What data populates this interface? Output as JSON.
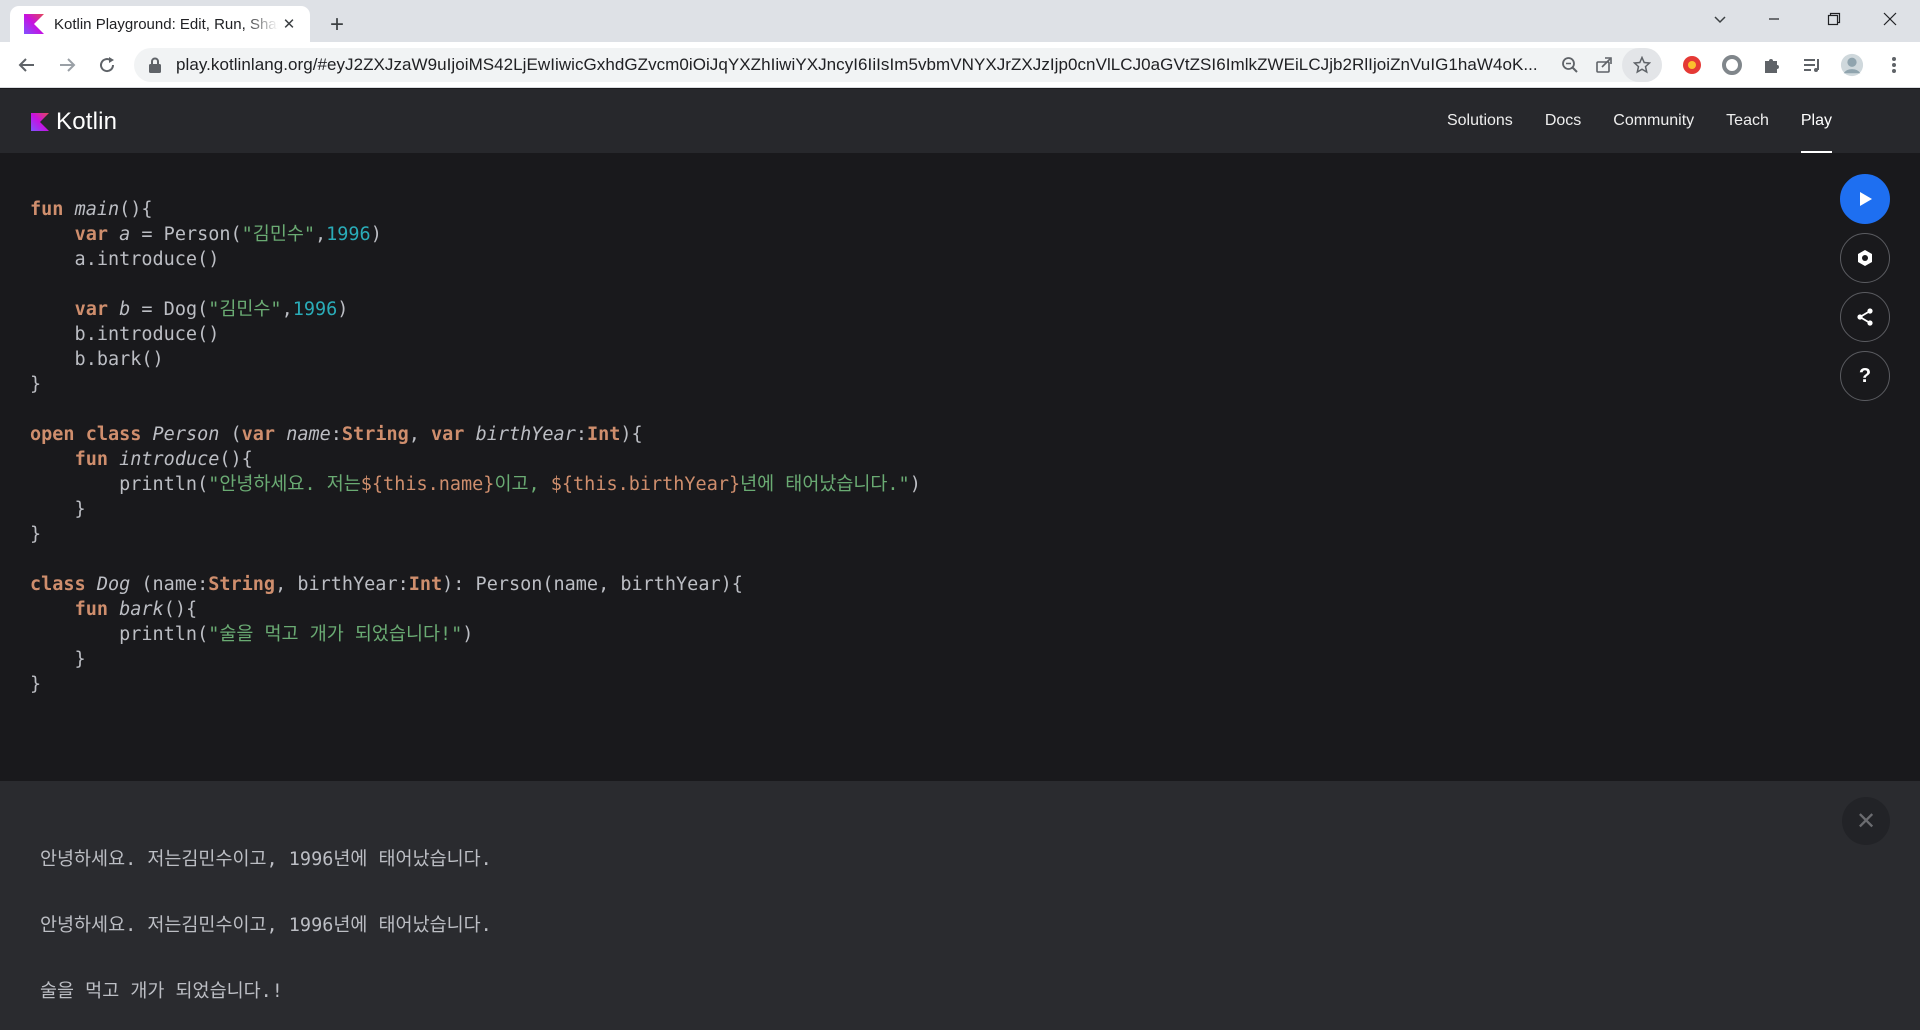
{
  "browser": {
    "tab_title": "Kotlin Playground: Edit, Run, Share Kotlin Code Online",
    "url": "play.kotlinlang.org/#eyJ2ZXJzaW9uIjoiMS42LjEwIiwicGxhdGZvcm0iOiJqYXZhIiwiYXJncyI6IiIsIm5vbmVNYXJrZXJzIjp0cnVlLCJ0aGVtZSI6ImlkZWEiLCJjb2RlIjoiZnVuIG1haW4oK...",
    "icons": [
      "back-icon",
      "forward-icon",
      "reload-icon",
      "lock-icon",
      "zoom-icon",
      "share-icon",
      "bookmark-star-icon",
      "extensions-icon",
      "reading-list-icon",
      "profile-avatar"
    ]
  },
  "header": {
    "logo_text": "Kotlin",
    "nav": [
      "Solutions",
      "Docs",
      "Community",
      "Teach",
      "Play"
    ],
    "active_nav": "Play"
  },
  "editor": {
    "lines": [
      "fun main(){",
      "    var a = Person(\"김민수\",1996)",
      "    a.introduce()",
      "",
      "    var b = Dog(\"김민수\",1996)",
      "    b.introduce()",
      "    b.bark()",
      "}",
      "",
      "open class Person (var name:String, var birthYear:Int){",
      "    fun introduce(){",
      "        println(\"안녕하세요. 저는${this.name}이고, ${this.birthYear}년에 태어났습니다.\")",
      "    }",
      "}",
      "",
      "class Dog (name:String, birthYear:Int): Person(name, birthYear){",
      "    fun bark(){",
      "        println(\"술을 먹고 개가 되었습니다!\")",
      "    }",
      "}"
    ]
  },
  "actions": {
    "run": "▶",
    "settings": "⬢",
    "share": "share",
    "help": "?"
  },
  "output": {
    "lines": [
      "안녕하세요. 저는김민수이고, 1996년에 태어났습니다.",
      "안녕하세요. 저는김민수이고, 1996년에 태어났습니다.",
      "술을 먹고 개가 되었습니다.!"
    ],
    "close": "✕"
  },
  "colors": {
    "keyword": "#cf8e6d",
    "string": "#6aab73",
    "number": "#2aacb8",
    "run_button": "#1e6ff1"
  }
}
